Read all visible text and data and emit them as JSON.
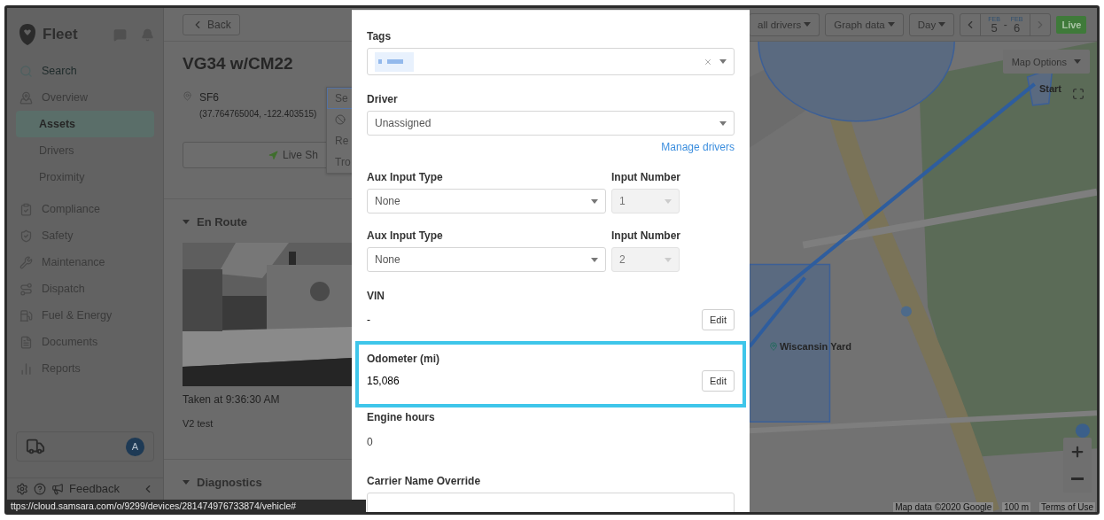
{
  "sidebar": {
    "brand": "Fleet",
    "search": {
      "placeholder": "Search"
    },
    "items": [
      {
        "label": "Overview",
        "selected": false,
        "children": [
          {
            "label": "Assets",
            "selected": true
          },
          {
            "label": "Drivers",
            "selected": false
          },
          {
            "label": "Proximity",
            "selected": false
          }
        ]
      },
      {
        "label": "Compliance",
        "selected": false
      },
      {
        "label": "Safety",
        "selected": false
      },
      {
        "label": "Maintenance",
        "selected": false
      },
      {
        "label": "Dispatch",
        "selected": false
      },
      {
        "label": "Fuel & Energy",
        "selected": false
      },
      {
        "label": "Documents",
        "selected": false
      },
      {
        "label": "Reports",
        "selected": false
      }
    ],
    "account": {
      "avatar": "A"
    },
    "footer": {
      "feedback": "Feedback"
    }
  },
  "detail": {
    "back": "Back",
    "title": "VG34 w/CM22",
    "location": "SF6",
    "coordinates": "(37.764765004, -122.403515)",
    "live_share": "Live Sh",
    "menu": [
      {
        "kind": "text",
        "label": "Se",
        "selected": true
      },
      {
        "kind": "icon",
        "selected": false
      },
      {
        "kind": "text",
        "label": "Re",
        "selected": false
      },
      {
        "kind": "text",
        "label": "Tro",
        "selected": false
      }
    ],
    "sections": [
      {
        "title": "En Route",
        "expanded": true,
        "caption": "Taken at 9:36:30 AM",
        "note": "V2 test"
      },
      {
        "title": "Diagnostics",
        "expanded": true
      }
    ]
  },
  "toolbar": {
    "buttons": [
      "all drivers",
      "Graph data",
      "Day"
    ],
    "date_range": {
      "start_month": "FEB",
      "start_day": "5",
      "separator": "-",
      "end_month": "FEB",
      "end_day": "6"
    },
    "next_disabled": true,
    "live": "Live"
  },
  "map": {
    "options": "Map Options",
    "markers": [
      {
        "kind": "start",
        "label": "Start"
      },
      {
        "kind": "place",
        "label": "Wiscansin Yard"
      }
    ],
    "attribution": "Map data ©2020 Google",
    "scale": "100 m",
    "terms": "Terms of Use"
  },
  "modal": {
    "fields": [
      {
        "kind": "tags",
        "label": "Tags",
        "clearable": true
      },
      {
        "kind": "select",
        "label": "Driver",
        "value": "Unassigned",
        "link": "Manage drivers"
      },
      {
        "kind": "aux",
        "label": "Aux Input Type",
        "value": "None",
        "number_label": "Input Number",
        "number": "1",
        "number_disabled": true
      },
      {
        "kind": "aux",
        "label": "Aux Input Type",
        "value": "None",
        "number_label": "Input Number",
        "number": "2",
        "number_disabled": true
      },
      {
        "kind": "edit",
        "label": "VIN",
        "value": "-",
        "button": "Edit",
        "highlighted": false
      },
      {
        "kind": "edit",
        "label": "Odometer (mi)",
        "value": "15,086",
        "button": "Edit",
        "highlighted": true
      },
      {
        "kind": "static",
        "label": "Engine hours",
        "value": "0"
      },
      {
        "kind": "input",
        "label": "Carrier Name Override"
      }
    ]
  },
  "status_url": "ttps://cloud.samsara.com/o/9299/devices/281474976733874/vehicle#"
}
